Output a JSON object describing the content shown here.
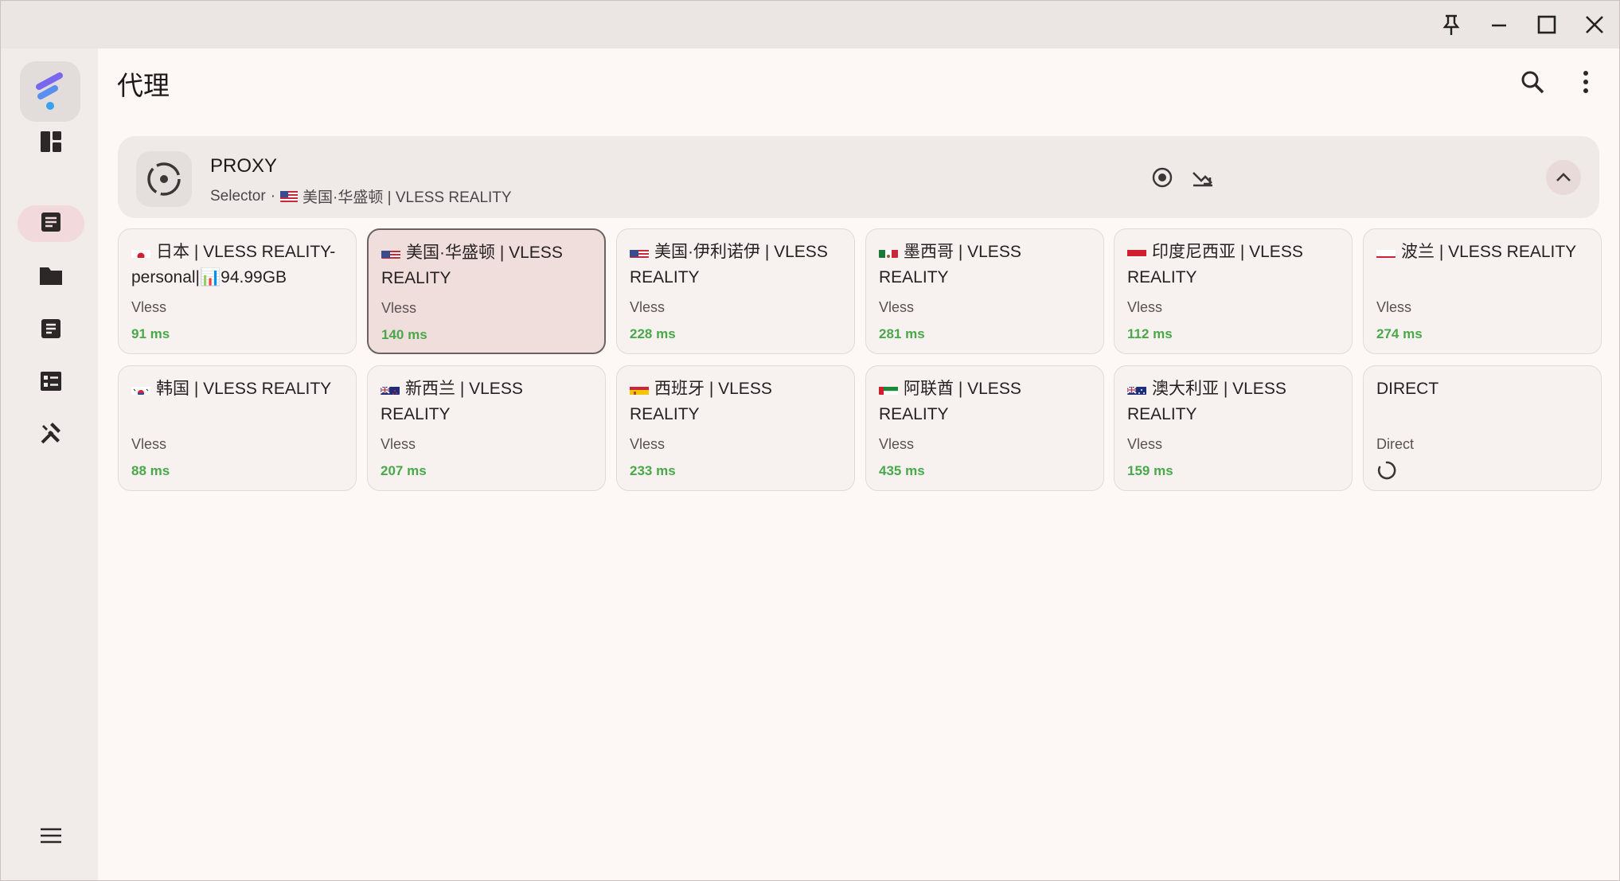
{
  "window": {
    "controls": [
      "pin-icon",
      "minimize-icon",
      "maximize-icon",
      "close-icon"
    ]
  },
  "sidebar": {
    "items": [
      {
        "name": "dashboard-icon",
        "active": false
      },
      {
        "name": "proxies-icon",
        "active": true
      },
      {
        "name": "profiles-icon",
        "active": false
      },
      {
        "name": "requests-icon",
        "active": false
      },
      {
        "name": "resources-icon",
        "active": false
      },
      {
        "name": "tools-icon",
        "active": false
      }
    ],
    "menu_icon": "menu-icon"
  },
  "header": {
    "title": "代理",
    "icons": [
      "search-icon",
      "more-vert-icon"
    ]
  },
  "group": {
    "name": "PROXY",
    "type": "Selector",
    "separator": "·",
    "current": "美国·华盛顿 | VLESS REALITY",
    "current_flag": "us",
    "actions": [
      "locate-icon",
      "test-delay-icon",
      "collapse-icon"
    ]
  },
  "proxies": [
    {
      "name": "日本 | VLESS REALITY-personal|📊94.99GB",
      "flag": "jp",
      "type": "Vless",
      "delay": "91 ms",
      "selected": false
    },
    {
      "name": "美国·华盛顿 | VLESS REALITY",
      "flag": "us",
      "type": "Vless",
      "delay": "140 ms",
      "selected": true
    },
    {
      "name": "美国·伊利诺伊 | VLESS REALITY",
      "flag": "us",
      "type": "Vless",
      "delay": "228 ms",
      "selected": false
    },
    {
      "name": "墨西哥 | VLESS REALITY",
      "flag": "mx",
      "type": "Vless",
      "delay": "281 ms",
      "selected": false
    },
    {
      "name": "印度尼西亚 | VLESS REALITY",
      "flag": "id",
      "type": "Vless",
      "delay": "112 ms",
      "selected": false
    },
    {
      "name": "波兰 | VLESS REALITY",
      "flag": "pl",
      "type": "Vless",
      "delay": "274 ms",
      "selected": false
    },
    {
      "name": "韩国 | VLESS REALITY",
      "flag": "kr",
      "type": "Vless",
      "delay": "88 ms",
      "selected": false
    },
    {
      "name": "新西兰 | VLESS REALITY",
      "flag": "nz",
      "type": "Vless",
      "delay": "207 ms",
      "selected": false
    },
    {
      "name": "西班牙 | VLESS REALITY",
      "flag": "es",
      "type": "Vless",
      "delay": "233 ms",
      "selected": false
    },
    {
      "name": "阿联酋 | VLESS REALITY",
      "flag": "ae",
      "type": "Vless",
      "delay": "435 ms",
      "selected": false
    },
    {
      "name": "澳大利亚 | VLESS REALITY",
      "flag": "au",
      "type": "Vless",
      "delay": "159 ms",
      "selected": false
    },
    {
      "name": "DIRECT",
      "flag": "",
      "type": "Direct",
      "delay": "",
      "selected": false,
      "testing": true
    }
  ],
  "colors": {
    "delay_good": "#4aa84a",
    "selected_bg": "#f0dedd",
    "active_nav": "#f2d9db"
  }
}
